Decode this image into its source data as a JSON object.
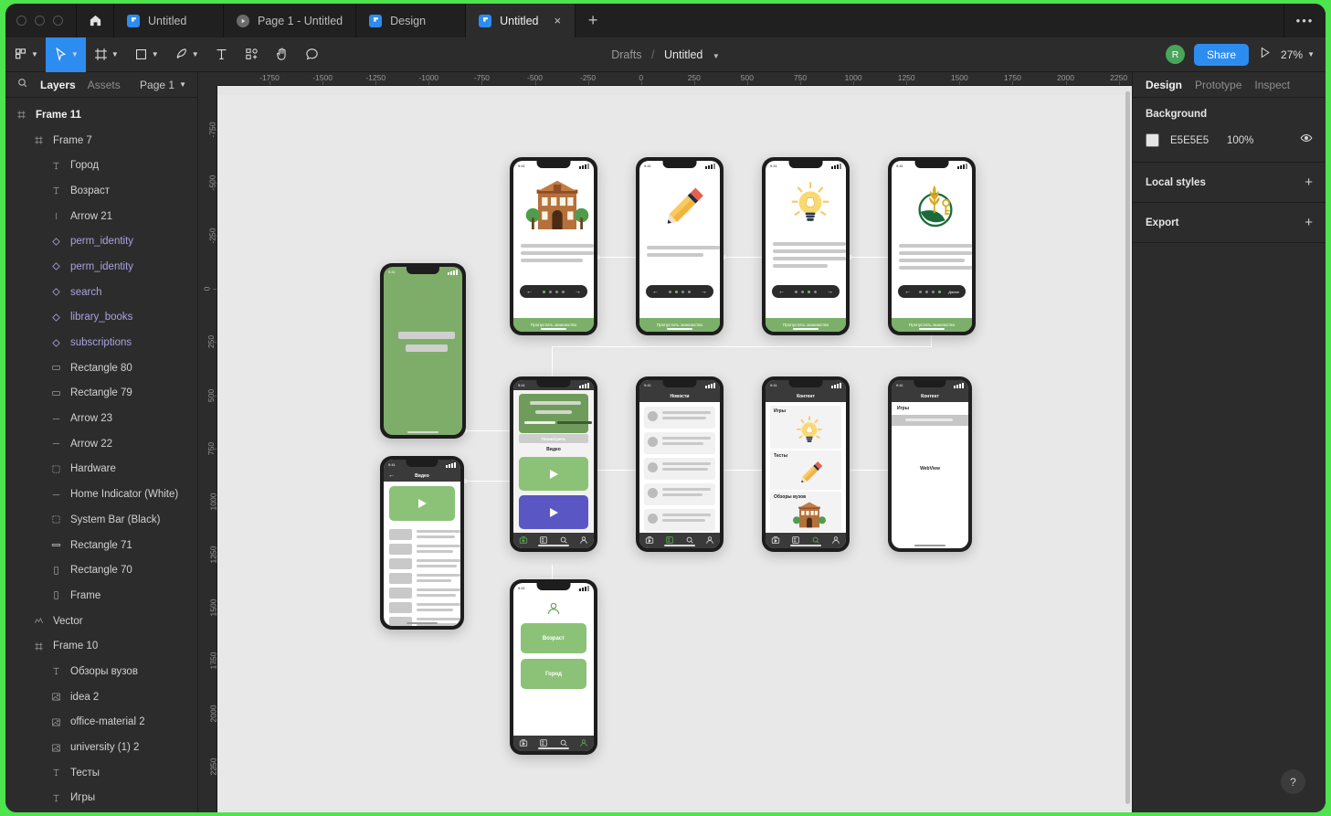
{
  "window": {
    "traffic_lights": [
      "close",
      "minimize",
      "maximize"
    ],
    "home_icon": "home-icon",
    "overflow_menu": "•••"
  },
  "tabs": [
    {
      "label": "Untitled",
      "icon": "figma-icon",
      "active": false
    },
    {
      "label": "Page 1 - Untitled",
      "icon": "play-icon",
      "active": false
    },
    {
      "label": "Design",
      "icon": "figma-icon",
      "active": false
    },
    {
      "label": "Untitled",
      "icon": "figma-icon",
      "active": true,
      "close": "×"
    }
  ],
  "new_tab_label": "+",
  "toolbar": {
    "tools": [
      {
        "name": "menu-icon",
        "caret": true,
        "selected": false
      },
      {
        "name": "move-cursor-icon",
        "caret": true,
        "selected": true
      },
      {
        "name": "frame-icon",
        "caret": true,
        "selected": false
      },
      {
        "name": "shape-rectangle-icon",
        "caret": true,
        "selected": false
      },
      {
        "name": "pen-icon",
        "caret": true,
        "selected": false
      },
      {
        "name": "text-icon",
        "caret": false,
        "selected": false
      },
      {
        "name": "components-icon",
        "caret": false,
        "selected": false
      },
      {
        "name": "hand-icon",
        "caret": false,
        "selected": false
      },
      {
        "name": "comment-icon",
        "caret": false,
        "selected": false
      }
    ],
    "breadcrumb_root": "Drafts",
    "breadcrumb_sep": "/",
    "breadcrumb_file": "Untitled",
    "avatar_initial": "R",
    "share_label": "Share",
    "present_icon": "present-play-icon",
    "zoom_level": "27%"
  },
  "left_panel": {
    "search_icon": "search-icon",
    "tabs": [
      {
        "label": "Layers",
        "active": true
      },
      {
        "label": "Assets",
        "active": false
      }
    ],
    "page_selector": "Page 1",
    "layers": [
      {
        "label": "Frame 11",
        "icon": "frame-icon",
        "indent": 0,
        "style": "bold"
      },
      {
        "label": "Frame 7",
        "icon": "frame-icon",
        "indent": 1,
        "style": "normal"
      },
      {
        "label": "Город",
        "icon": "text-icon",
        "indent": 2,
        "style": "normal"
      },
      {
        "label": "Возраст",
        "icon": "text-icon",
        "indent": 2,
        "style": "normal"
      },
      {
        "label": "Arrow 21",
        "icon": "line-vertical-icon",
        "indent": 2,
        "style": "normal"
      },
      {
        "label": "perm_identity",
        "icon": "component-icon",
        "indent": 2,
        "style": "component"
      },
      {
        "label": "perm_identity",
        "icon": "component-icon",
        "indent": 2,
        "style": "component"
      },
      {
        "label": "search",
        "icon": "component-icon",
        "indent": 2,
        "style": "component"
      },
      {
        "label": "library_books",
        "icon": "component-icon",
        "indent": 2,
        "style": "component"
      },
      {
        "label": "subscriptions",
        "icon": "component-icon",
        "indent": 2,
        "style": "component"
      },
      {
        "label": "Rectangle 80",
        "icon": "rectangle-icon",
        "indent": 2,
        "style": "normal"
      },
      {
        "label": "Rectangle 79",
        "icon": "rectangle-icon",
        "indent": 2,
        "style": "normal"
      },
      {
        "label": "Arrow 23",
        "icon": "line-horizontal-icon",
        "indent": 2,
        "style": "normal"
      },
      {
        "label": "Arrow 22",
        "icon": "line-horizontal-icon",
        "indent": 2,
        "style": "normal"
      },
      {
        "label": "Hardware",
        "icon": "group-icon",
        "indent": 2,
        "style": "normal"
      },
      {
        "label": "Home Indicator (White)",
        "icon": "line-horizontal-icon",
        "indent": 2,
        "style": "normal"
      },
      {
        "label": "System Bar (Black)",
        "icon": "group-icon",
        "indent": 2,
        "style": "normal"
      },
      {
        "label": "Rectangle 71",
        "icon": "rectangle-wide-icon",
        "indent": 2,
        "style": "normal"
      },
      {
        "label": "Rectangle 70",
        "icon": "rectangle-tall-icon",
        "indent": 2,
        "style": "normal"
      },
      {
        "label": "Frame",
        "icon": "rectangle-tall-icon",
        "indent": 2,
        "style": "normal"
      },
      {
        "label": "Vector",
        "icon": "vector-icon",
        "indent": 1,
        "style": "normal"
      },
      {
        "label": "Frame 10",
        "icon": "frame-icon",
        "indent": 1,
        "style": "normal"
      },
      {
        "label": "Обзоры вузов",
        "icon": "text-icon",
        "indent": 2,
        "style": "normal"
      },
      {
        "label": "idea 2",
        "icon": "image-icon",
        "indent": 2,
        "style": "normal"
      },
      {
        "label": "office-material 2",
        "icon": "image-icon",
        "indent": 2,
        "style": "normal"
      },
      {
        "label": "university (1) 2",
        "icon": "image-icon",
        "indent": 2,
        "style": "normal"
      },
      {
        "label": "Тесты",
        "icon": "text-icon",
        "indent": 2,
        "style": "normal"
      },
      {
        "label": "Игры",
        "icon": "text-icon",
        "indent": 2,
        "style": "normal"
      }
    ]
  },
  "right_panel": {
    "tabs": [
      {
        "label": "Design",
        "active": true
      },
      {
        "label": "Prototype",
        "active": false
      },
      {
        "label": "Inspect",
        "active": false
      }
    ],
    "background": {
      "title": "Background",
      "color_hex": "E5E5E5",
      "opacity": "100%",
      "visibility_icon": "eye-icon"
    },
    "local_styles": {
      "title": "Local styles",
      "add": "+"
    },
    "export": {
      "title": "Export",
      "add": "+"
    },
    "help_button": "?"
  },
  "canvas": {
    "frame_label": "Frame 11",
    "background_hex": "#E5E5E5",
    "ruler_top": [
      "-1750",
      "-1500",
      "-1250",
      "-1000",
      "-750",
      "-500",
      "-250",
      "0",
      "250",
      "500",
      "750",
      "1000",
      "1250",
      "1500",
      "1750",
      "2000",
      "2250"
    ],
    "ruler_left": [
      "-750",
      "-500",
      "-250",
      "0",
      "250",
      "500",
      "750",
      "1000",
      "1250",
      "1500",
      "1750",
      "2000",
      "2250"
    ],
    "accent_green": "#8CC278",
    "accent_purple": "#5A56C4",
    "screens": [
      {
        "id": "onboard-university",
        "title": "",
        "illustration": "university-building-illustration",
        "skip_label": "Пропустить знакомство",
        "active_dot": 1
      },
      {
        "id": "onboard-tests",
        "title": "",
        "illustration": "pencil-illustration",
        "skip_label": "Пропустить знакомство",
        "active_dot": 2
      },
      {
        "id": "onboard-games",
        "title": "",
        "illustration": "lightbulb-illustration",
        "skip_label": "Пропустить знакомство",
        "active_dot": 3
      },
      {
        "id": "onboard-logo",
        "title": "",
        "illustration": "rshb-logo-illustration",
        "skip_label": "Пропустить знакомство",
        "next_label": "Далее",
        "active_dot": 4
      },
      {
        "id": "splash-green",
        "title": "",
        "illustration": "green-splash"
      },
      {
        "id": "home-feed",
        "title": "",
        "promo_button": "Посмотреть",
        "section_label": "Видео"
      },
      {
        "id": "video-detail",
        "title": "Видео"
      },
      {
        "id": "news-list",
        "title": "Новости"
      },
      {
        "id": "content-categories",
        "title": "Контент",
        "categories": [
          "Игры",
          "Тесты",
          "Обзоры вузов"
        ]
      },
      {
        "id": "content-webview",
        "title": "Контент",
        "tab_label": "Игры",
        "body_label": "WebView"
      },
      {
        "id": "profile",
        "title": "",
        "buttons": [
          "Возраст",
          "Город"
        ]
      }
    ]
  }
}
